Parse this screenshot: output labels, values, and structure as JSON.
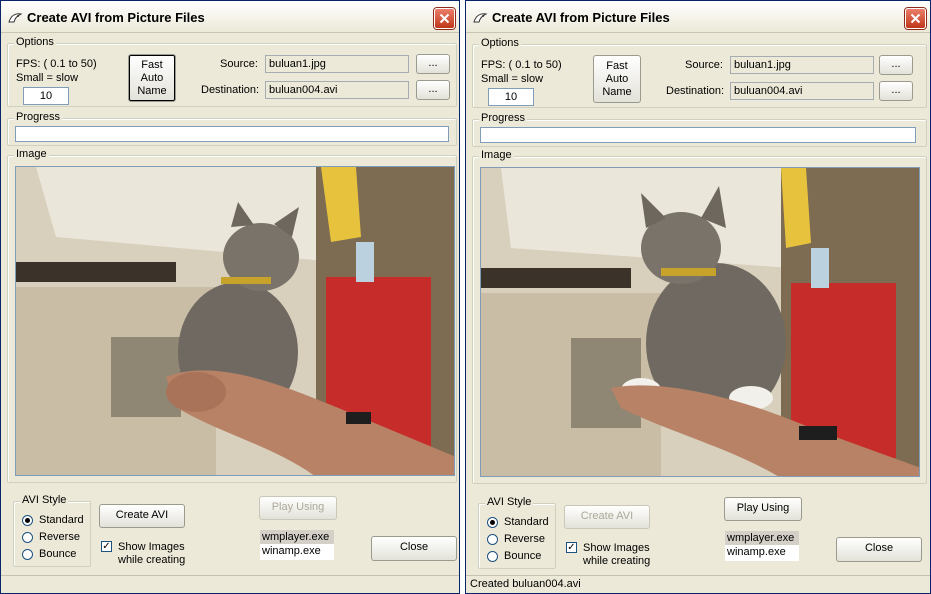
{
  "windows": [
    {
      "title": "Create AVI from Picture Files",
      "options": {
        "legend": "Options",
        "fps_label": "FPS: ( 0.1 to 50)",
        "small_slow_label": "Small = slow",
        "fps_value": "10",
        "fast_auto_name": [
          "Fast",
          "Auto",
          "Name"
        ],
        "source_label": "Source:",
        "source_value": "buluan1.jpg",
        "destination_label": "Destination:",
        "destination_value": "buluan004.avi",
        "browse_label": "..."
      },
      "progress": {
        "legend": "Progress",
        "fraction": 0
      },
      "image": {
        "legend": "Image",
        "description": "kitten held in hand"
      },
      "avi_style": {
        "legend": "AVI Style",
        "options": [
          "Standard",
          "Reverse",
          "Bounce"
        ],
        "selected": "Standard"
      },
      "create_avi_label": "Create AVI",
      "create_avi_enabled": true,
      "play_using_label": "Play Using",
      "play_using_enabled": false,
      "show_images_label": [
        "Show Images",
        "while creating"
      ],
      "show_images_checked": true,
      "players": [
        "wmplayer.exe",
        "winamp.exe"
      ],
      "selected_player": "wmplayer.exe",
      "close_label": "Close",
      "status": ""
    },
    {
      "title": "Create AVI from Picture Files",
      "options": {
        "legend": "Options",
        "fps_label": "FPS: ( 0.1 to 50)",
        "small_slow_label": "Small = slow",
        "fps_value": "10",
        "fast_auto_name": [
          "Fast",
          "Auto",
          "Name"
        ],
        "source_label": "Source:",
        "source_value": "buluan1.jpg",
        "destination_label": "Destination:",
        "destination_value": "buluan004.avi",
        "browse_label": "..."
      },
      "progress": {
        "legend": "Progress",
        "fraction": 0
      },
      "image": {
        "legend": "Image",
        "description": "kitten held in hand"
      },
      "avi_style": {
        "legend": "AVI Style",
        "options": [
          "Standard",
          "Reverse",
          "Bounce"
        ],
        "selected": "Standard"
      },
      "create_avi_label": "Create AVI",
      "create_avi_enabled": false,
      "play_using_label": "Play Using",
      "play_using_enabled": true,
      "show_images_label": [
        "Show Images",
        "while creating"
      ],
      "show_images_checked": true,
      "players": [
        "wmplayer.exe",
        "winamp.exe"
      ],
      "selected_player": "wmplayer.exe",
      "close_label": "Close",
      "status": "Created buluan004.avi"
    }
  ],
  "colors": {
    "window_bg": "#ece9d8",
    "close_red": "#c1361a",
    "list_selected": "#d4d0c8"
  }
}
